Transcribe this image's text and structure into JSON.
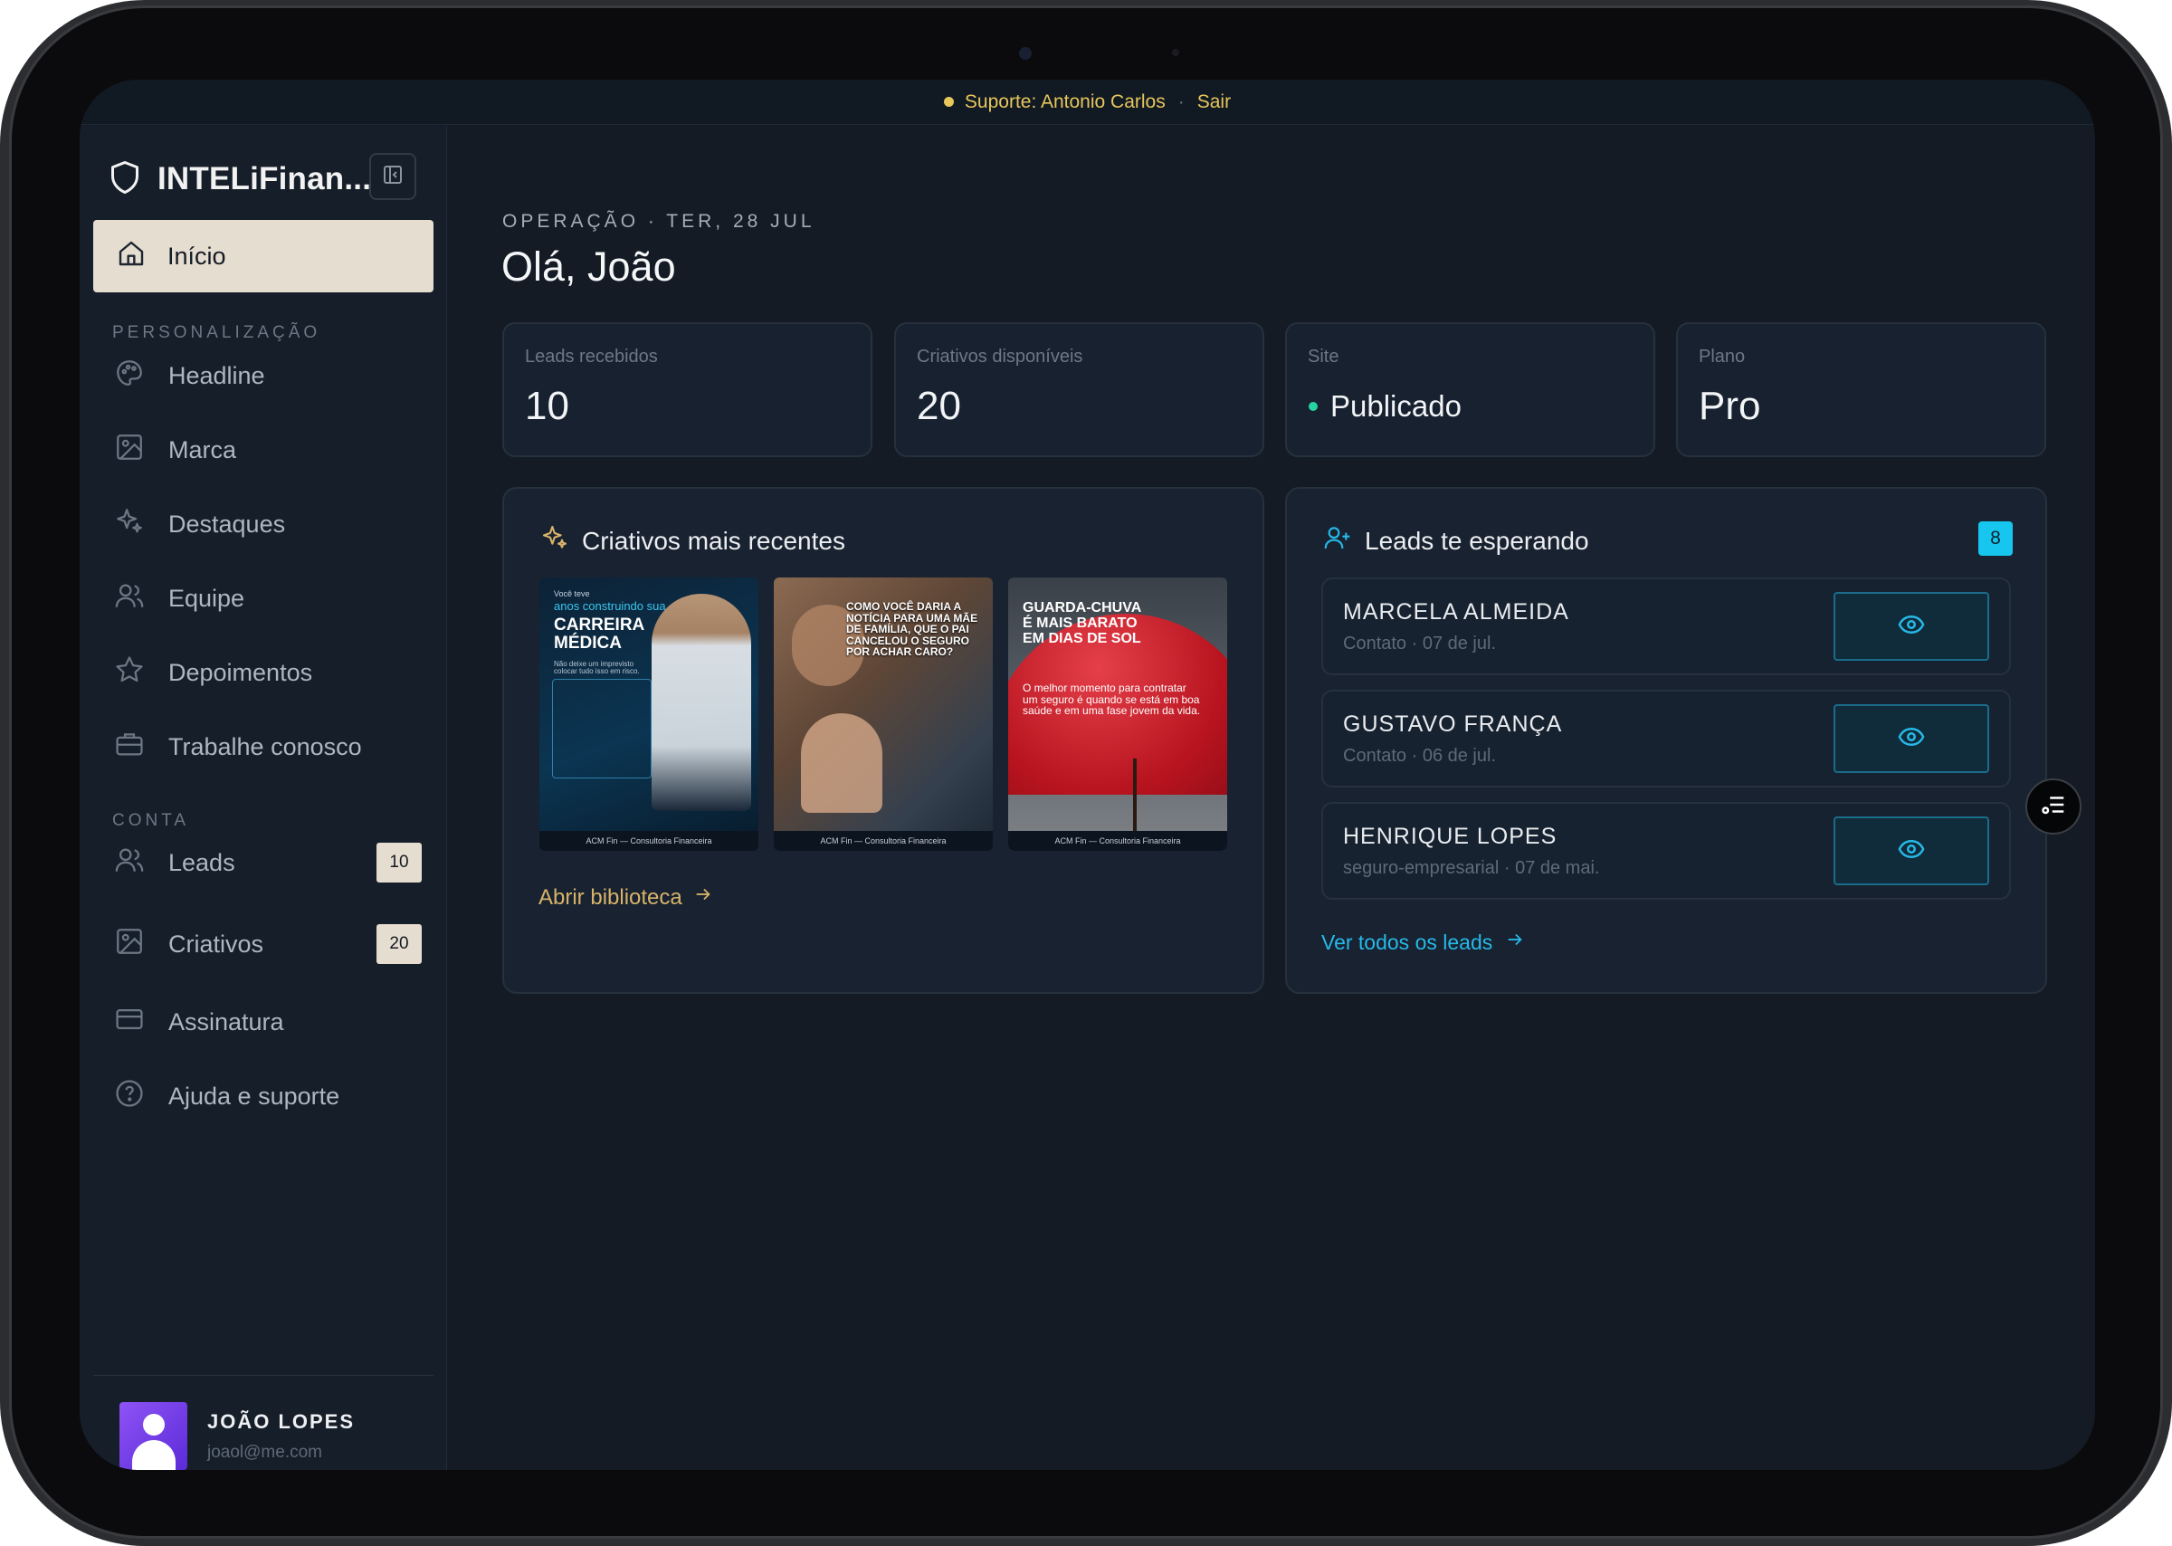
{
  "topbar": {
    "support": "Suporte: Antonio Carlos",
    "separator": "·",
    "logout": "Sair"
  },
  "sidebar": {
    "brand": "INTELiFinan...",
    "home": "Início",
    "section_personalizacao": "PERSONALIZAÇÃO",
    "personalizacao_items": [
      "Headline",
      "Marca",
      "Destaques",
      "Equipe",
      "Depoimentos",
      "Trabalhe conosco"
    ],
    "section_conta": "CONTA",
    "conta_items": [
      {
        "label": "Leads",
        "badge": "10"
      },
      {
        "label": "Criativos",
        "badge": "20"
      },
      {
        "label": "Assinatura",
        "badge": ""
      },
      {
        "label": "Ajuda e suporte",
        "badge": ""
      }
    ],
    "user": {
      "name": "JOÃO LOPES",
      "email": "joaol@me.com"
    }
  },
  "main": {
    "eyebrow": "OPERAÇÃO · TER, 28 JUL",
    "greeting": "Olá, João",
    "stats": [
      {
        "label": "Leads recebidos",
        "value": "10"
      },
      {
        "label": "Criativos disponíveis",
        "value": "20"
      },
      {
        "label": "Site",
        "value": "Publicado"
      },
      {
        "label": "Plano",
        "value": "Pro"
      }
    ],
    "criativos": {
      "title": "Criativos mais recentes",
      "thumbs": [
        {
          "small": "Você teve",
          "accent": "anos construindo sua",
          "headline": "CARREIRA MÉDICA",
          "body": "Não deixe um imprevisto colocar tudo isso em risco.",
          "footer": "ACM Fin — Consultoria Financeira"
        },
        {
          "headline": "COMO VOCÊ DARIA A NOTÍCIA PARA UMA MÃE DE FAMÍLIA, QUE O PAI CANCELOU O SEGURO POR ACHAR CARO?",
          "footer": "ACM Fin — Consultoria Financeira"
        },
        {
          "headline": "GUARDA-CHUVA É MAIS BARATO EM DIAS DE SOL",
          "body": "O melhor momento para contratar um seguro é quando se está em boa saúde e em uma fase jovem da vida.",
          "footer": "ACM Fin — Consultoria Financeira"
        }
      ],
      "link": "Abrir biblioteca"
    },
    "leads": {
      "title": "Leads te esperando",
      "badge": "8",
      "items": [
        {
          "name": "MARCELA ALMEIDA",
          "meta": "Contato · 07 de jul."
        },
        {
          "name": "GUSTAVO FRANÇA",
          "meta": "Contato · 06 de jul."
        },
        {
          "name": "HENRIQUE LOPES",
          "meta": "seguro-empresarial · 07 de mai."
        }
      ],
      "link": "Ver todos os leads"
    }
  },
  "colors": {
    "accent_gold": "#e7c65b",
    "accent_cyan": "#16c6ee",
    "status_green": "#27d3a0",
    "active_nav_bg": "#e6ddd1"
  },
  "icons": [
    "shield-icon",
    "sidebar-collapse-icon",
    "home-icon",
    "palette-icon",
    "image-icon",
    "sparkles-icon",
    "users-icon",
    "star-icon",
    "briefcase-icon",
    "credit-card-icon",
    "help-circle-icon",
    "user-plus-icon",
    "eye-icon",
    "arrow-right-icon",
    "filter-lines-icon"
  ]
}
